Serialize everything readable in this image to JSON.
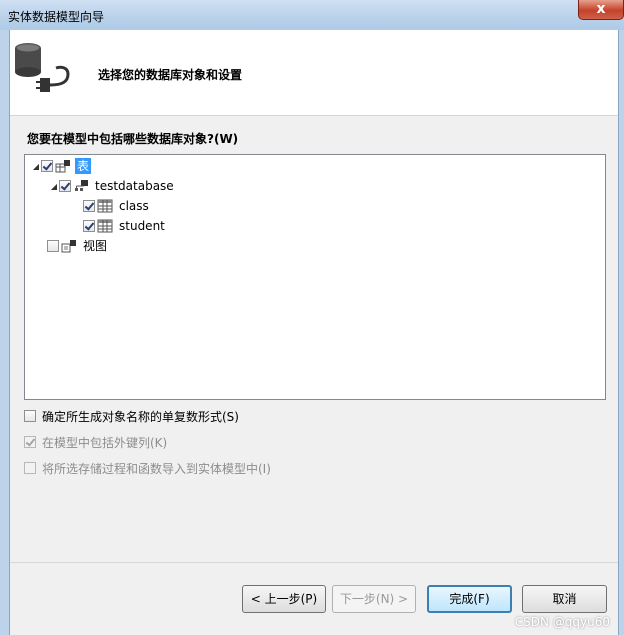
{
  "window": {
    "title": "实体数据模型向导",
    "close_glyph": "x"
  },
  "header": {
    "title": "选择您的数据库对象和设置",
    "icon": "database-plug-icon"
  },
  "question": "您要在模型中包括哪些数据库对象?(W)",
  "tree": {
    "tables": {
      "label": "表",
      "checked": true,
      "expanded": true,
      "db": {
        "label": "testdatabase",
        "checked": true,
        "expanded": true,
        "items": [
          {
            "label": "class",
            "checked": true
          },
          {
            "label": "student",
            "checked": true
          }
        ]
      }
    },
    "views": {
      "label": "视图",
      "checked": false
    }
  },
  "options": [
    {
      "label": "确定所生成对象名称的单复数形式(S)",
      "checked": false,
      "enabled": true
    },
    {
      "label": "在模型中包括外键列(K)",
      "checked": true,
      "enabled": false
    },
    {
      "label": "将所选存储过程和函数导入到实体模型中(I)",
      "checked": false,
      "enabled": false
    }
  ],
  "buttons": {
    "prev": "< 上一步(P)",
    "next": "下一步(N) >",
    "finish": "完成(F)",
    "cancel": "取消"
  },
  "watermark": "CSDN @qqyu60"
}
